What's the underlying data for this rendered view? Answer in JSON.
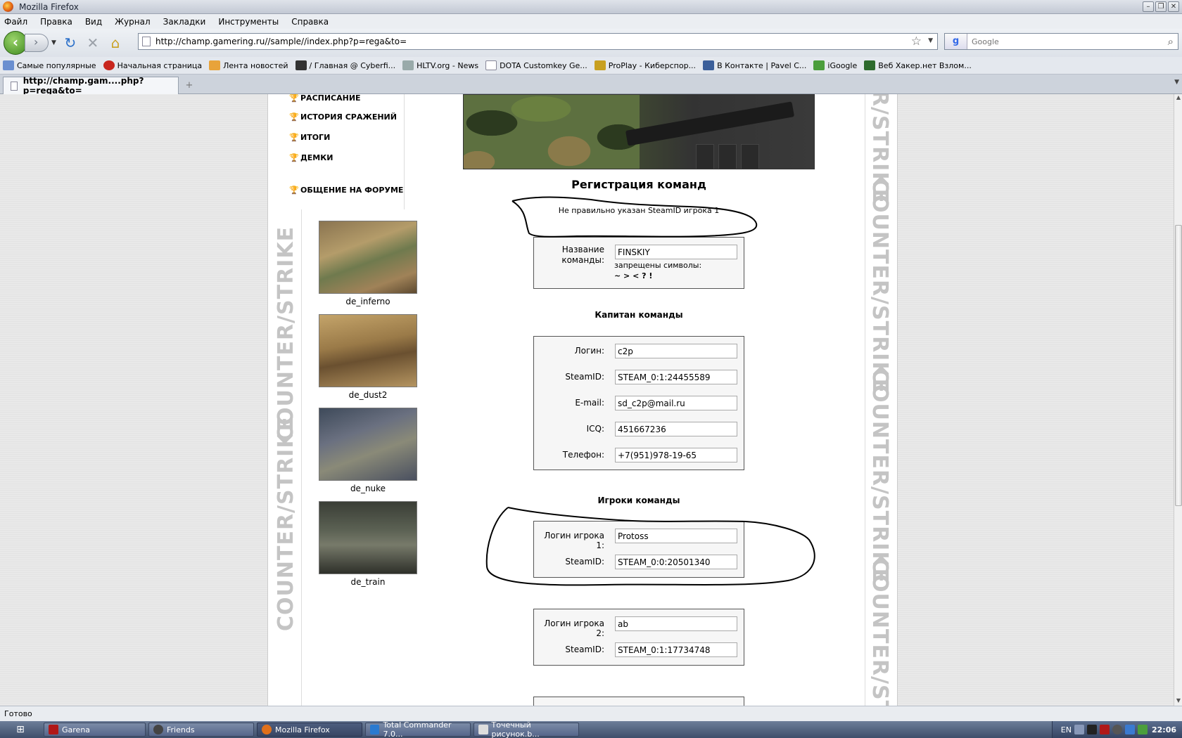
{
  "window": {
    "title": "Mozilla Firefox"
  },
  "menubar": [
    "Файл",
    "Правка",
    "Вид",
    "Журнал",
    "Закладки",
    "Инструменты",
    "Справка"
  ],
  "navigation": {
    "url": "http://champ.gamering.ru//sample//index.php?p=rega&to=",
    "search_placeholder": "Google"
  },
  "bookmarks": [
    {
      "label": "Самые популярные",
      "color": "#6a8fd0"
    },
    {
      "label": "Начальная страница",
      "color": "#c8261e"
    },
    {
      "label": "Лента новостей",
      "color": "#e8a33a"
    },
    {
      "label": "/ Главная @ Cyberfi...",
      "color": "#333333"
    },
    {
      "label": "HLTV.org - News",
      "color": "#9aa"
    },
    {
      "label": "DOTA Customkey Ge...",
      "color": "#ffffff"
    },
    {
      "label": "ProPlay - Киберспор...",
      "color": "#c8a020"
    },
    {
      "label": "В Контакте | Pavel C...",
      "color": "#3b5f9a"
    },
    {
      "label": "iGoogle",
      "color": "#4b9e3c"
    },
    {
      "label": "Веб Хакер.нет Взлом...",
      "color": "#2d6b2d"
    }
  ],
  "tab": {
    "label": "http://champ.gam....php?p=rega&to="
  },
  "site": {
    "menu": [
      "РАСПИСАНИЕ",
      "ИСТОРИЯ СРАЖЕНИЙ",
      "ИТОГИ",
      "ДЕМКИ",
      "ОБЩЕНИЕ НА ФОРУМЕ"
    ],
    "maps": [
      "de_inferno",
      "de_dust2",
      "de_nuke",
      "de_train"
    ],
    "cs_logo": "COUNTER/STRIKE",
    "form": {
      "title": "Регистрация команд",
      "error": "Не правильно указан SteamID игрока 1",
      "team_name_label": "Название команды:",
      "team_name_value": "FINSKIY",
      "forbidden_note": "запрещены символы:",
      "forbidden_chars": "~ > < ? !",
      "captain_title": "Капитан команды",
      "captain": [
        {
          "label": "Логин:",
          "value": "c2p"
        },
        {
          "label": "SteamID:",
          "value": "STEAM_0:1:24455589"
        },
        {
          "label": "E-mail:",
          "value": "sd_c2p@mail.ru"
        },
        {
          "label": "ICQ:",
          "value": "451667236"
        },
        {
          "label": "Телефон:",
          "value": "+7(951)978-19-65"
        }
      ],
      "players_title": "Игроки команды",
      "players": [
        {
          "login_label": "Логин игрока 1:",
          "login": "Protoss",
          "steam_label": "SteamID:",
          "steam": "STEAM_0:0:20501340"
        },
        {
          "login_label": "Логин игрока 2:",
          "login": "ab",
          "steam_label": "SteamID:",
          "steam": "STEAM_0:1:17734748"
        }
      ]
    }
  },
  "status": "Готово",
  "taskbar": {
    "tasks": [
      {
        "label": "Garena",
        "color": "#b01818",
        "active": false
      },
      {
        "label": "Friends",
        "color": "#444444",
        "active": false
      },
      {
        "label": "Mozilla Firefox",
        "color": "#e0701a",
        "active": true
      },
      {
        "label": "Total Commander 7.0...",
        "color": "#2a7ad0",
        "active": false
      },
      {
        "label": "Точечный рисунок.b...",
        "color": "#dddddd",
        "active": false
      }
    ],
    "lang": "EN",
    "clock": "22:06"
  }
}
